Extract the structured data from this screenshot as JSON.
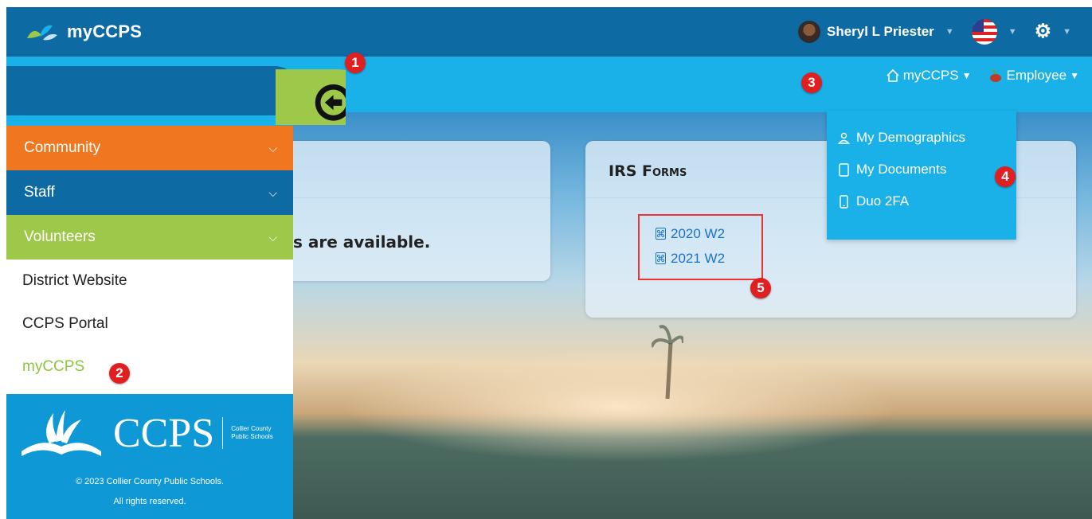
{
  "topbar": {
    "brand": "myCCPS",
    "user_name": "Sheryl L Priester"
  },
  "subnav": {
    "home_label": "myCCPS",
    "employee_label": "Employee"
  },
  "dropdown": {
    "items": [
      {
        "label": "My Demographics",
        "icon": "person-icon"
      },
      {
        "label": "My Documents",
        "icon": "document-icon"
      },
      {
        "label": "Duo 2FA",
        "icon": "phone-icon"
      }
    ]
  },
  "sidebar": {
    "categories": [
      {
        "label": "Community",
        "color": "#f0771f"
      },
      {
        "label": "Staff",
        "color": "#0d6aa3"
      },
      {
        "label": "Volunteers",
        "color": "#9dc84a"
      }
    ],
    "links": [
      {
        "label": "District Website"
      },
      {
        "label": "CCPS Portal"
      },
      {
        "label": "myCCPS"
      }
    ],
    "footer": {
      "logo_text": "CCPS",
      "logo_sub_1": "Collier County",
      "logo_sub_2": "Public Schools",
      "copyright_1": "© 2023 Collier County Public Schools.",
      "copyright_2": "All rights reserved."
    }
  },
  "main": {
    "left_card_message": "s are available.",
    "irs_card": {
      "title": "IRS Forms",
      "links": [
        "2020 W2",
        "2021 W2"
      ]
    }
  },
  "annotations": [
    "1",
    "2",
    "3",
    "4",
    "5"
  ],
  "colors": {
    "topbar": "#0d6aa3",
    "subbar": "#1ab1e8",
    "community": "#f0771f",
    "volunteers": "#9dc84a",
    "annotation": "#e02020"
  }
}
